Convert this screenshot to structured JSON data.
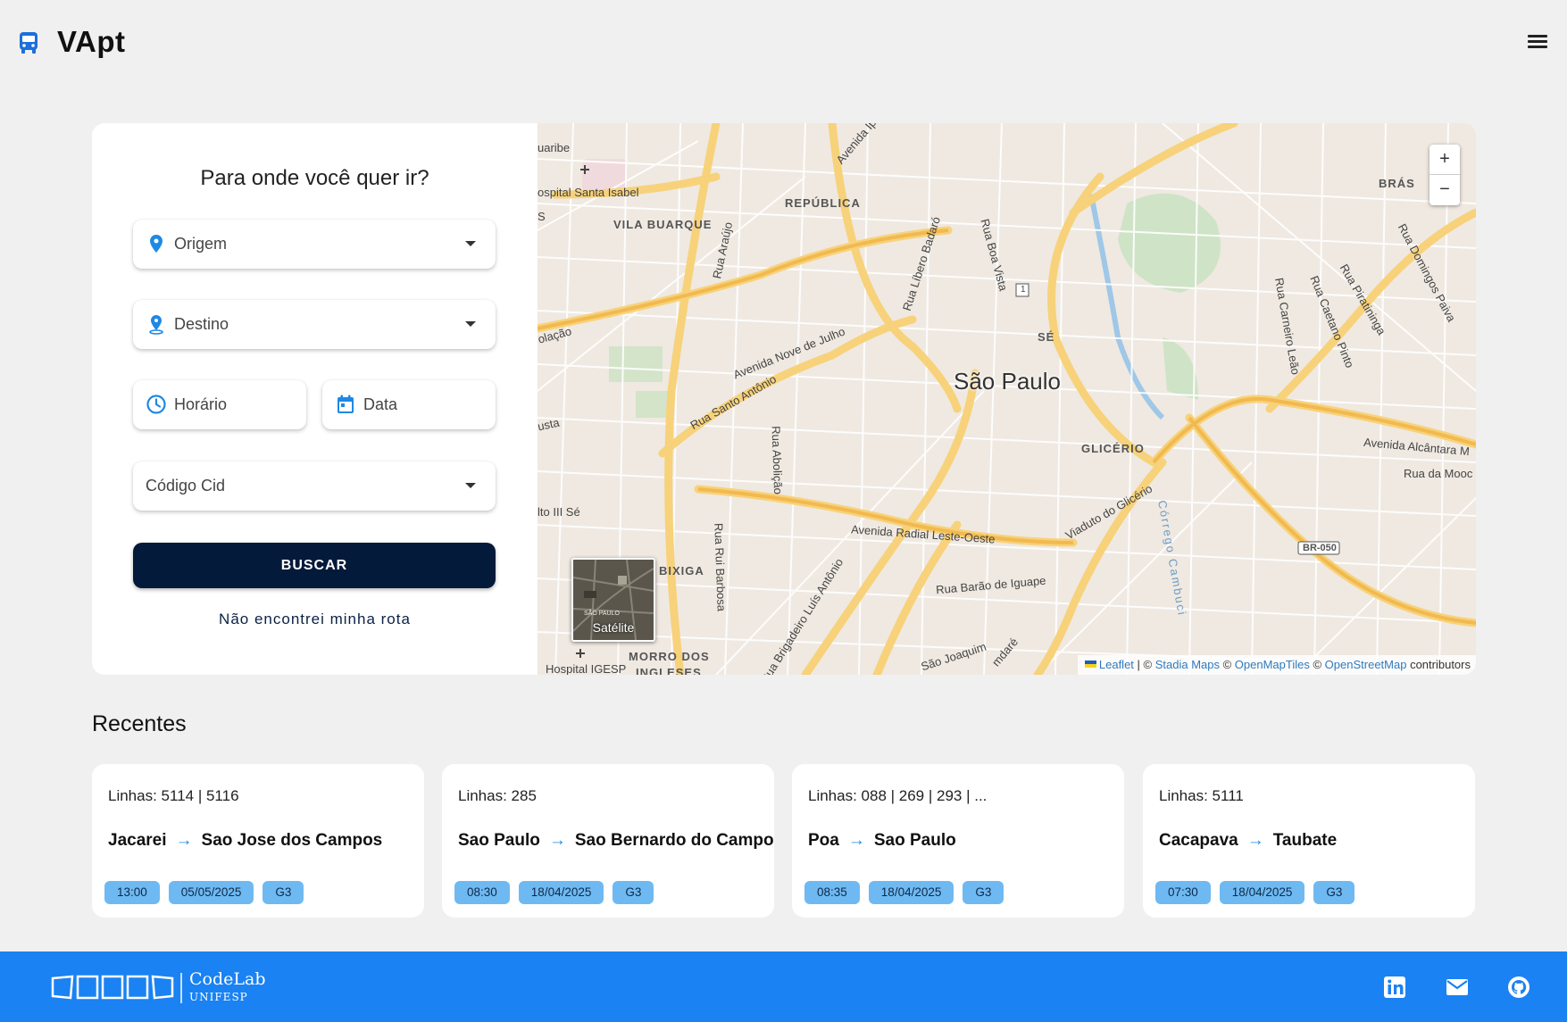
{
  "header": {
    "brand": "VApt"
  },
  "search": {
    "title": "Para onde você quer ir?",
    "origin_label": "Origem",
    "destination_label": "Destino",
    "time_label": "Horário",
    "date_label": "Data",
    "code_label": "Código Cid",
    "search_button": "BUSCAR",
    "not_found_link": "Não encontrei minha rota"
  },
  "map": {
    "city": "São Paulo",
    "zoom_in": "+",
    "zoom_out": "−",
    "satellite_label": "Satélite",
    "satellite_thumb_text": "SÃO PAULO",
    "labels": [
      "REPÚBLICA",
      "VILA BUARQUE",
      "SÉ",
      "GLICÉRIO",
      "BIXIGA",
      "BRÁS",
      "MORRO DOS",
      "INGLESES",
      "ospital Santa Isabel",
      "Hospital IGESP",
      "lto III Sé",
      "uaribe",
      "Avenida Nove de Julho",
      "Rua Santo Antônio",
      "Rua Abolição",
      "Rua Rui Barbosa",
      "Avenida Radial Leste-Oeste",
      "Viaduto do Glicério",
      "Rua Barão de Iguape",
      "Rua Líbero Badaró",
      "Rua Boa Vista",
      "Avenida Alcântara M",
      "Rua da Mooc",
      "Rua Araújo",
      "Córrego Cambuci",
      "BR-050",
      "Avenida Ipir",
      "Rua Caetano Pinto",
      "Rua Piratininga",
      "Rua Carneiro Leão",
      "Rua Domingos Paiva",
      "Rua Brigadeiro Luís Antônio",
      "olação",
      "usta",
      "1",
      "S",
      "São Joaquim",
      "mdaré"
    ],
    "attribution": {
      "leaflet": "Leaflet",
      "sep1": " | © ",
      "stadia": "Stadia Maps",
      "sep2": " © ",
      "omt": "OpenMapTiles",
      "sep3": " © ",
      "osm": "OpenStreetMap",
      "tail": " contributors"
    }
  },
  "recent": {
    "title": "Recentes",
    "cards": [
      {
        "lines": "Linhas: 5114 | 5116",
        "from": "Jacarei",
        "to": "Sao Jose dos Campos",
        "time": "13:00",
        "date": "05/05/2025",
        "tag": "G3"
      },
      {
        "lines": "Linhas: 285",
        "from": "Sao Paulo",
        "to": "Sao Bernardo do Campo",
        "time": "08:30",
        "date": "18/04/2025",
        "tag": "G3"
      },
      {
        "lines": "Linhas: 088 | 269 | 293 | ...",
        "from": "Poa",
        "to": "Sao Paulo",
        "time": "08:35",
        "date": "18/04/2025",
        "tag": "G3"
      },
      {
        "lines": "Linhas: 5111",
        "from": "Cacapava",
        "to": "Taubate",
        "time": "07:30",
        "date": "18/04/2025",
        "tag": "G3"
      }
    ]
  },
  "footer": {
    "org_name": "CodeLab",
    "org_sub": "UNIFESP",
    "links": [
      "linkedin-icon",
      "mail-icon",
      "github-icon"
    ]
  },
  "colors": {
    "accent": "#1e88e5",
    "button": "#041a3a",
    "chip": "#6fb9f2",
    "footer": "#1a82f2"
  }
}
